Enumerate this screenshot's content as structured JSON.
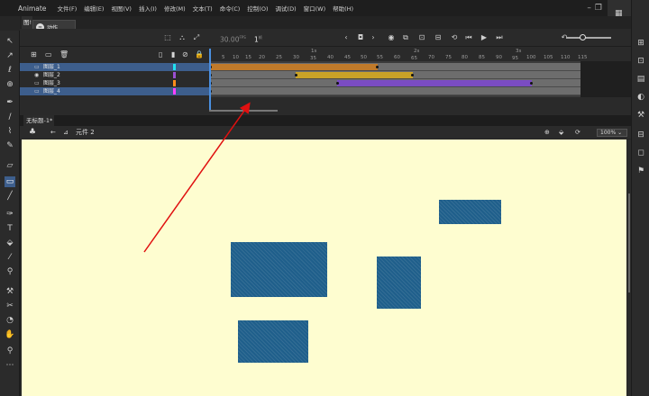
{
  "app": {
    "name": "Animate"
  },
  "menu": [
    "文件(F)",
    "编辑(E)",
    "视图(V)",
    "插入(I)",
    "修改(M)",
    "文本(T)",
    "命令(C)",
    "控制(O)",
    "调试(D)",
    "窗口(W)",
    "帮助(H)"
  ],
  "panel": {
    "tab_label": "图!",
    "actions_label": "动作"
  },
  "timeline": {
    "fps": "30.00",
    "fps_unit": "FPS",
    "current_frame": "1",
    "frame_unit": "帧",
    "ruler_minor": [
      "5",
      "10",
      "15",
      "20",
      "25",
      "30",
      "35",
      "40",
      "45",
      "50",
      "55",
      "60",
      "65",
      "70",
      "75",
      "80",
      "85",
      "90",
      "95",
      "100",
      "105",
      "110",
      "115"
    ],
    "ruler_major": [
      "1s",
      "2s",
      "3s"
    ],
    "layers": [
      {
        "name": "图层_1",
        "color": "#22e0f0",
        "selected": true
      },
      {
        "name": "图层_2",
        "color": "#9a4fd1",
        "selected": false
      },
      {
        "name": "图层_3",
        "color": "#ff8c1a",
        "selected": false
      },
      {
        "name": "图层_4",
        "color": "#ff40ff",
        "selected": true
      }
    ]
  },
  "document": {
    "tab": "无标题-1*",
    "symbol": "元件 2",
    "zoom": "100%"
  },
  "colors": {
    "stage": "#fefdd0",
    "shape": "#1f5f8b",
    "arrow": "#e01010"
  }
}
